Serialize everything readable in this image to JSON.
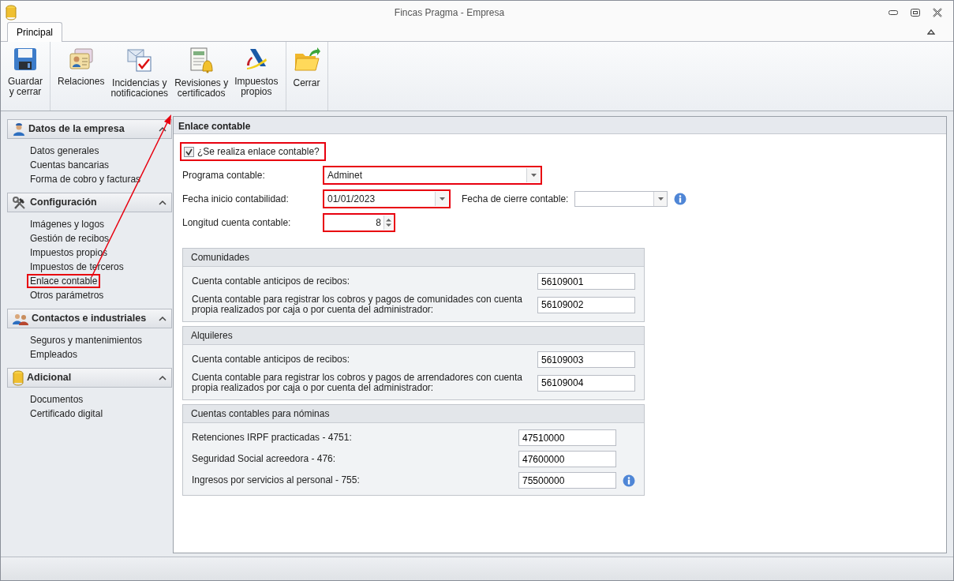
{
  "window": {
    "title": "Fincas Pragma - Empresa"
  },
  "ribbon": {
    "tabs": [
      {
        "label": "Principal",
        "selected": true
      }
    ],
    "groups": [
      [
        {
          "lines": [
            "Guardar",
            "y cerrar"
          ]
        }
      ],
      [
        {
          "lines": [
            "Relaciones"
          ]
        },
        {
          "lines": [
            "Incidencias y",
            "notificaciones"
          ]
        },
        {
          "lines": [
            "Revisiones y",
            "certificados"
          ]
        },
        {
          "lines": [
            "Impuestos",
            "propios"
          ]
        }
      ],
      [
        {
          "lines": [
            "Cerrar"
          ]
        }
      ]
    ]
  },
  "sidebar": {
    "sections": [
      {
        "title": "Datos de la empresa",
        "expanded": true,
        "items": [
          {
            "label": "Datos generales",
            "highlighted": false
          },
          {
            "label": "Cuentas bancarias",
            "highlighted": false
          },
          {
            "label": "Forma de cobro y facturas",
            "highlighted": false
          }
        ]
      },
      {
        "title": "Configuración",
        "expanded": true,
        "items": [
          {
            "label": "Imágenes y logos",
            "highlighted": false
          },
          {
            "label": "Gestión de recibos",
            "highlighted": false
          },
          {
            "label": "Impuestos propios",
            "highlighted": false
          },
          {
            "label": "Impuestos de terceros",
            "highlighted": false
          },
          {
            "label": "Enlace contable",
            "highlighted": true
          },
          {
            "label": "Otros parámetros",
            "highlighted": false
          }
        ]
      },
      {
        "title": "Contactos e industriales",
        "expanded": true,
        "items": [
          {
            "label": "Seguros y mantenimientos",
            "highlighted": false
          },
          {
            "label": "Empleados",
            "highlighted": false
          }
        ]
      },
      {
        "title": "Adicional",
        "expanded": true,
        "items": [
          {
            "label": "Documentos",
            "highlighted": false
          },
          {
            "label": "Certificado digital",
            "highlighted": false
          }
        ]
      }
    ]
  },
  "panel": {
    "title": "Enlace contable",
    "checkbox": {
      "label": "¿Se realiza enlace contable?",
      "checked": true,
      "highlighted": true
    },
    "rows": [
      [
        {
          "kind": "combo",
          "label": "Programa contable:",
          "value": "Adminet",
          "highlighted": true
        }
      ],
      [
        {
          "kind": "combo",
          "label": "Fecha inicio contabilidad:",
          "value": "01/01/2023",
          "highlighted": true
        },
        {
          "kind": "combo",
          "label": "Fecha de cierre contable:",
          "highlighted": false
        },
        {
          "kind": "info"
        }
      ],
      [
        {
          "kind": "spin",
          "label": "Longitud cuenta contable:",
          "value": "8",
          "highlighted": true
        }
      ]
    ],
    "groups": [
      {
        "title": "Comunidades",
        "fields": [
          {
            "kind": "text",
            "label": "Cuenta contable anticipos de recibos:",
            "value": "56109001"
          },
          {
            "kind": "text",
            "label": "Cuenta contable para registrar los cobros y pagos de comunidades con cuenta propia realizados por caja o por cuenta del administrador:",
            "value": "56109002"
          }
        ]
      },
      {
        "title": "Alquileres",
        "fields": [
          {
            "kind": "text",
            "label": "Cuenta contable anticipos de recibos:",
            "value": "56109003"
          },
          {
            "kind": "text",
            "label": "Cuenta contable para registrar los cobros y pagos de arrendadores con cuenta propia realizados por caja o por cuenta del administrador:",
            "value": "56109004"
          }
        ]
      },
      {
        "title": "Cuentas contables para nóminas",
        "fields": [
          {
            "kind": "text",
            "label": "Retenciones IRPF practicadas - 4751:",
            "value": "47510000"
          },
          {
            "kind": "text",
            "label": "Seguridad Social acreedora - 476:",
            "value": "47600000"
          },
          {
            "kind": "text",
            "label": "Ingresos por servicios al personal - 755:",
            "value": "75500000"
          },
          {
            "kind": "info"
          }
        ]
      }
    ]
  }
}
